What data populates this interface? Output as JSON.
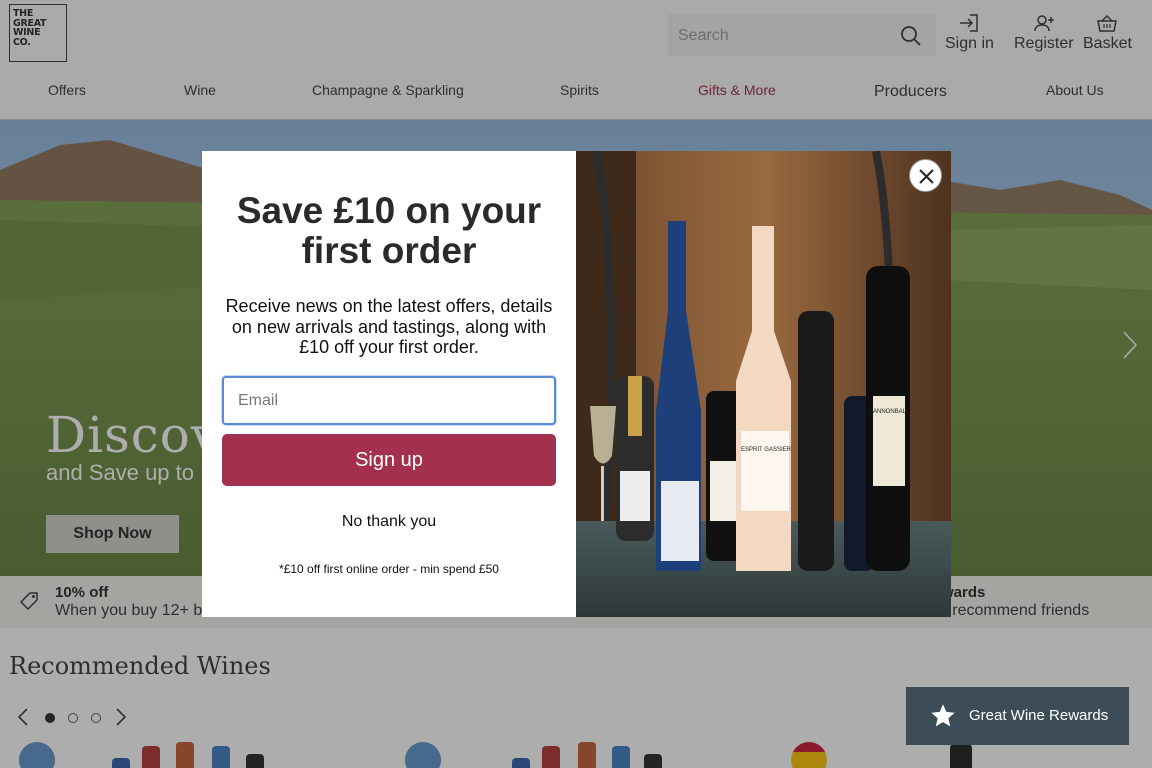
{
  "header": {
    "logo_lines": [
      "THE",
      "GREAT",
      "WINE",
      "CO."
    ],
    "search_placeholder": "Search",
    "sign_in": "Sign in",
    "register": "Register",
    "basket": "Basket"
  },
  "nav": [
    "Offers",
    "Wine",
    "Champagne & Sparkling",
    "Spirits",
    "Gifts & More",
    "Producers",
    "About Us"
  ],
  "hero": {
    "title": "Discove",
    "subtitle": "and Save up to",
    "cta": "Shop Now"
  },
  "usp": {
    "left_title": "10% off",
    "left_text": "When you buy 12+ b",
    "right_title": "wards",
    "right_text": "nd recommend friends"
  },
  "recommended": {
    "title": "Recommended Wines",
    "dots": 3,
    "active_dot": 0
  },
  "modal": {
    "title_line1": "Save £10 on your",
    "title_line2": "first order",
    "body": "Receive news on the latest offers, details on new arrivals and tastings, along with £10 off your first order.",
    "email_placeholder": "Email",
    "signup": "Sign up",
    "no_thanks": "No thank you",
    "fine_print": "*£10 off first online order - min spend £50",
    "bottle_labels": [
      "CANNONBALL",
      "ESPRIT GASSIER"
    ]
  },
  "rewards": {
    "label": "Great Wine Rewards"
  },
  "colors": {
    "accent": "#a3304c",
    "gift_nav": "#9a2540",
    "rewards_bg": "#3d4d58"
  }
}
